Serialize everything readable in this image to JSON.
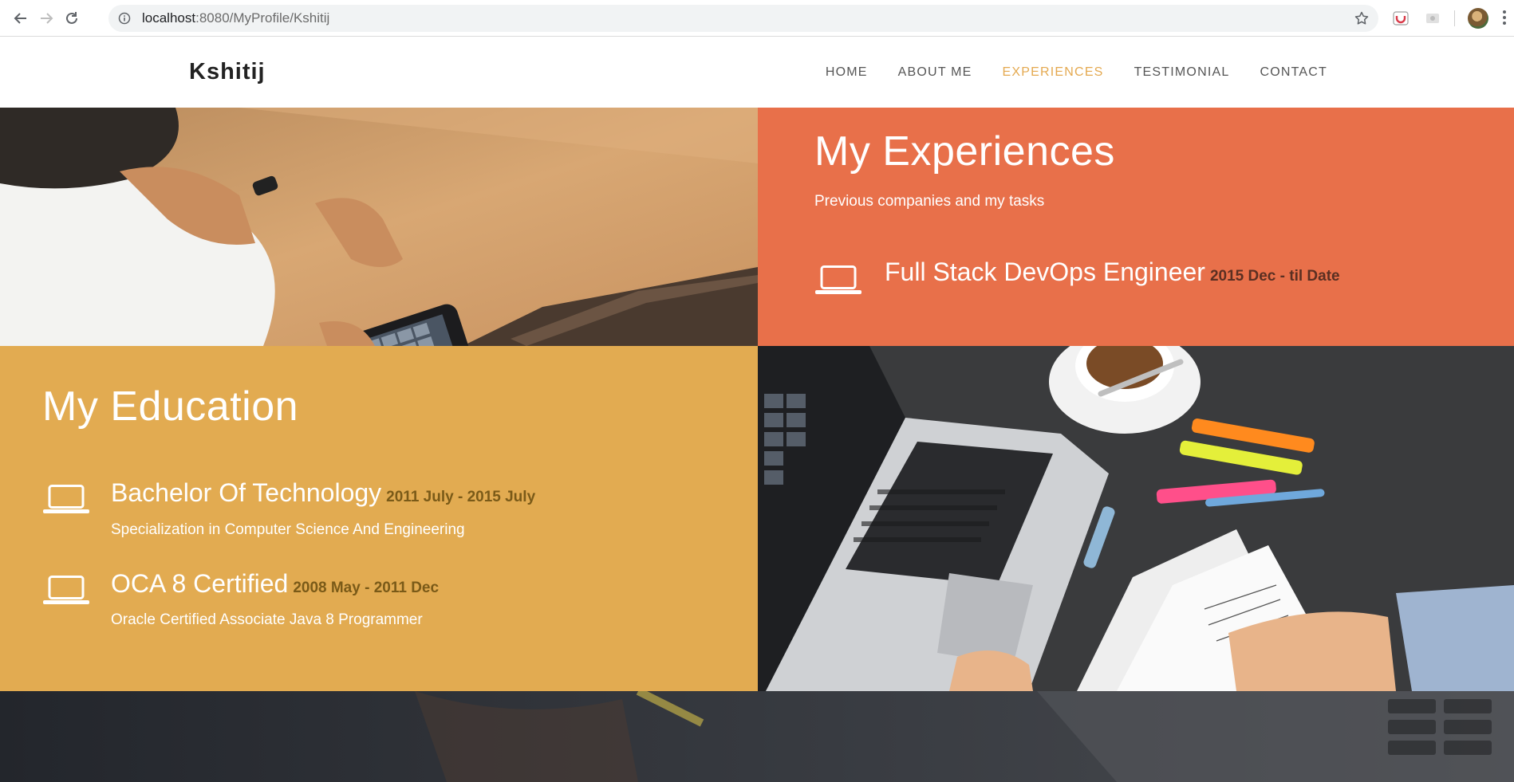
{
  "browser": {
    "url_host": "localhost",
    "url_path": ":8080/MyProfile/Kshitij"
  },
  "header": {
    "brand": "Kshitij",
    "nav": [
      {
        "label": "HOME"
      },
      {
        "label": "ABOUT ME"
      },
      {
        "label": "EXPERIENCES"
      },
      {
        "label": "TESTIMONIAL"
      },
      {
        "label": "CONTACT"
      }
    ],
    "active_index": 2
  },
  "experiences": {
    "title": "My Experiences",
    "subtitle": "Previous companies and my tasks",
    "items": [
      {
        "role": "Full Stack DevOps Engineer",
        "dates": "2015 Dec - til Date"
      }
    ]
  },
  "education": {
    "title": "My Education",
    "items": [
      {
        "degree": "Bachelor Of Technology",
        "dates": "2011 July - 2015 July",
        "desc": "Specialization in Computer Science And Engineering"
      },
      {
        "degree": "OCA 8 Certified",
        "dates": "2008 May - 2011 Dec",
        "desc": "Oracle Certified Associate Java 8 Programmer"
      }
    ]
  },
  "icons": {
    "nav_back": "arrow-back-icon",
    "nav_forward": "arrow-forward-icon",
    "reload": "reload-icon",
    "site_info": "info-icon",
    "bookmark": "star-icon",
    "entry": "laptop-icon"
  },
  "colors": {
    "accent_active_nav": "#e4a950",
    "experiences_bg": "#e8704a",
    "education_bg": "#e2ab51",
    "experience_dates": "#5a2f22",
    "education_dates": "#7a5a18"
  }
}
